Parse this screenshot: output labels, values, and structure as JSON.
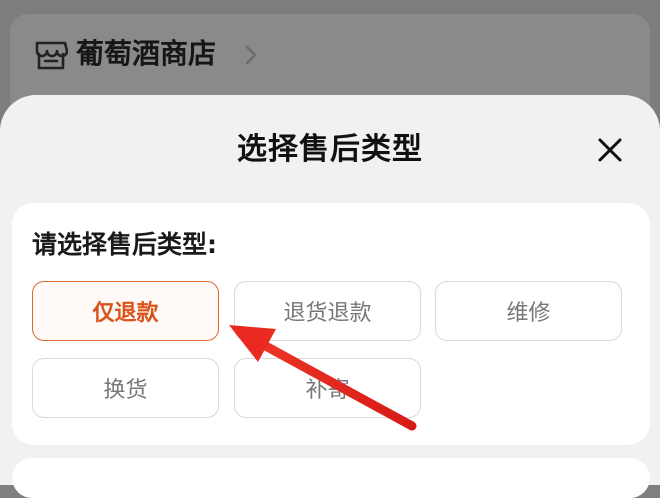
{
  "store": {
    "name": "葡萄酒商店"
  },
  "sheet": {
    "title": "选择售后类型",
    "prompt": "请选择售后类型:",
    "options": [
      {
        "label": "仅退款",
        "selected": true
      },
      {
        "label": "退货退款",
        "selected": false
      },
      {
        "label": "维修",
        "selected": false
      },
      {
        "label": "换货",
        "selected": false
      },
      {
        "label": "补寄",
        "selected": false
      }
    ]
  },
  "colors": {
    "accent": "#d9531a",
    "arrow": "#e0201c",
    "overlay": "#7f7f7f"
  }
}
